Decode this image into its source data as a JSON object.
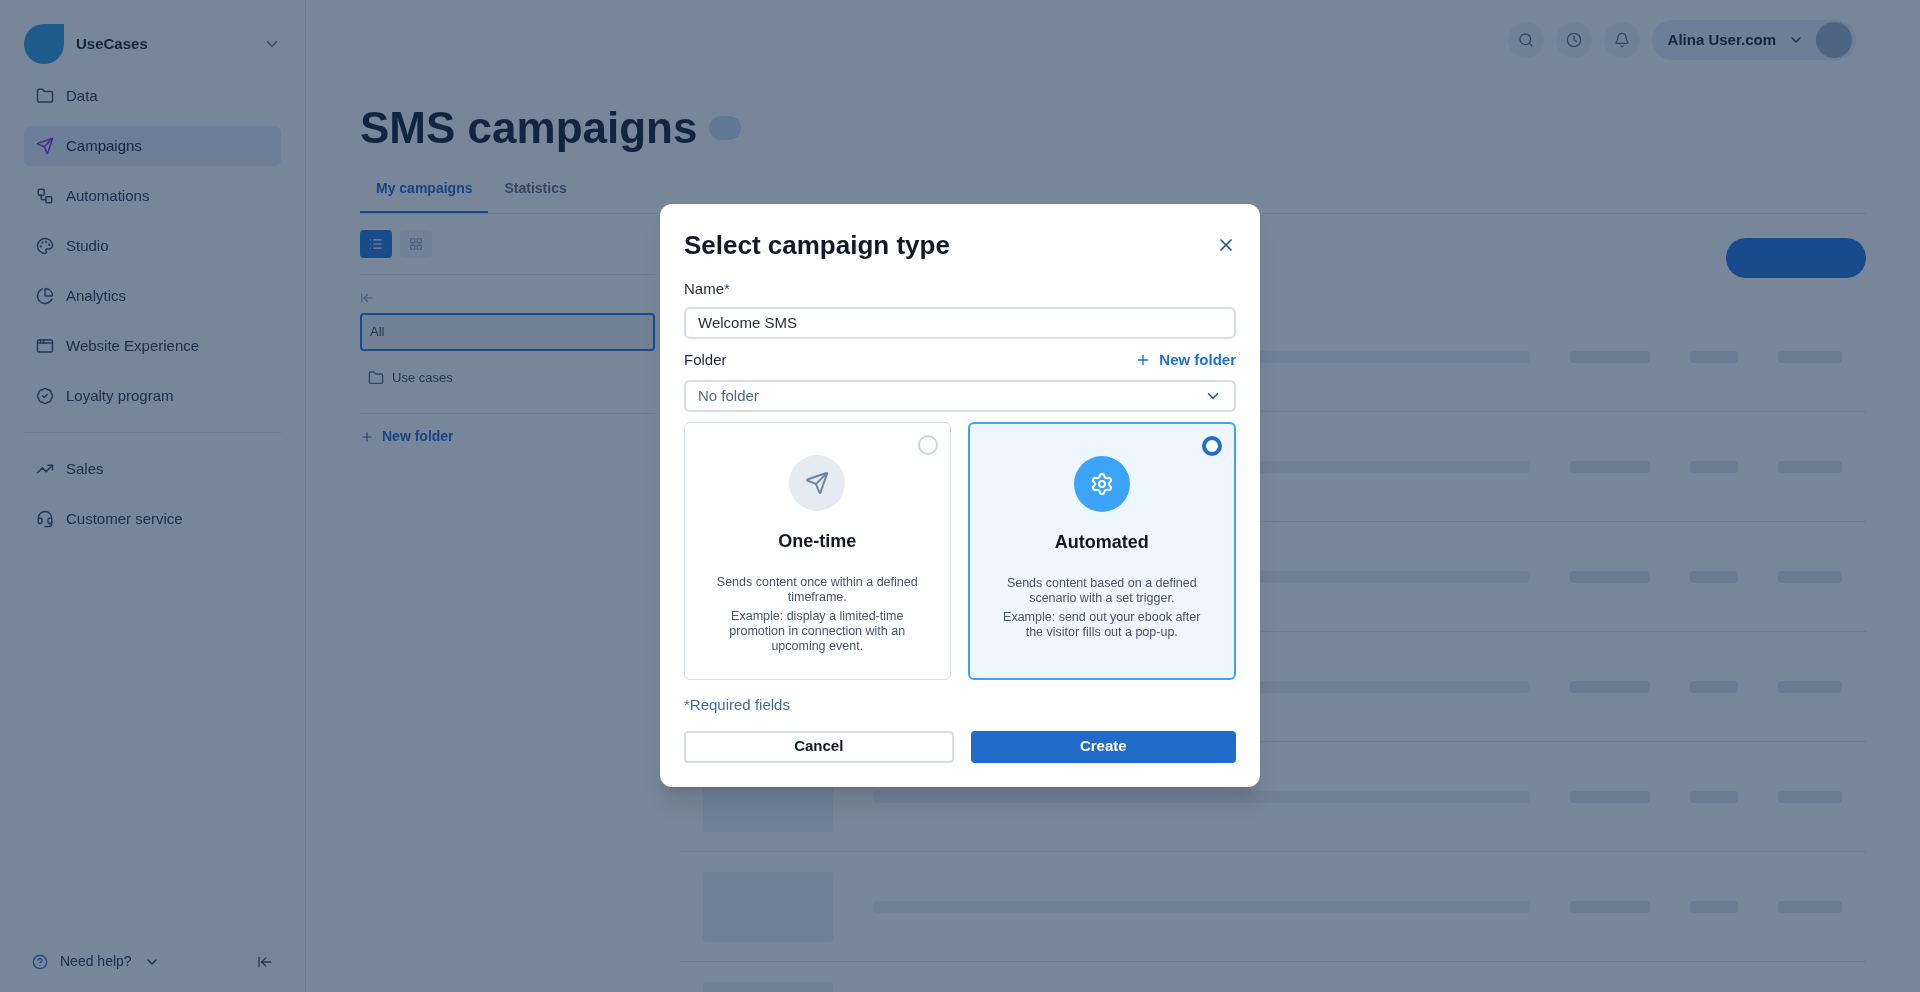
{
  "sidebar": {
    "workspace": "UseCases",
    "items": [
      {
        "label": "Data",
        "kind": "folder",
        "selected": false
      },
      {
        "label": "Campaigns",
        "kind": "send",
        "selected": true
      },
      {
        "label": "Automations",
        "kind": "flow",
        "selected": false
      },
      {
        "label": "Studio",
        "kind": "palette",
        "selected": false
      },
      {
        "label": "Analytics",
        "kind": "chart",
        "selected": false
      },
      {
        "label": "Website Experience",
        "kind": "browser",
        "selected": false
      },
      {
        "label": "Loyalty program",
        "kind": "badge",
        "selected": false
      }
    ],
    "items_2": [
      {
        "label": "Sales",
        "kind": "sales",
        "selected": false
      },
      {
        "label": "Customer service",
        "kind": "headset",
        "selected": false
      }
    ],
    "help": "Need help?"
  },
  "header": {
    "user": "Alina User.com"
  },
  "page": {
    "title": "SMS campaigns",
    "tabs": [
      {
        "label": "My campaigns",
        "selected": true
      },
      {
        "label": "Statistics",
        "selected": false
      }
    ],
    "folders": [
      {
        "label": "All",
        "selected": true
      },
      {
        "label": "Use cases",
        "selected": false
      }
    ],
    "new_folder": "New folder"
  },
  "dialog": {
    "title": "Select campaign type",
    "name_label": "Name",
    "required_mark": "*",
    "name_value": "Welcome SMS",
    "folder_label": "Folder",
    "new_folder": "New folder",
    "folder_value": "No folder",
    "types": [
      {
        "kind": "send",
        "title": "One-time",
        "description": "Sends content once within a defined timeframe.",
        "example": "Example: display a limited-time promotion in connection with an upcoming event.",
        "selected": false
      },
      {
        "kind": "gear",
        "title": "Automated",
        "description": "Sends content based on a defined scenario with a set trigger.",
        "example": "Example: send out your ebook after the visitor fills out a pop-up.",
        "selected": true
      }
    ],
    "required_note": "*Required fields",
    "buttons": {
      "cancel": "Cancel",
      "create": "Create"
    }
  }
}
